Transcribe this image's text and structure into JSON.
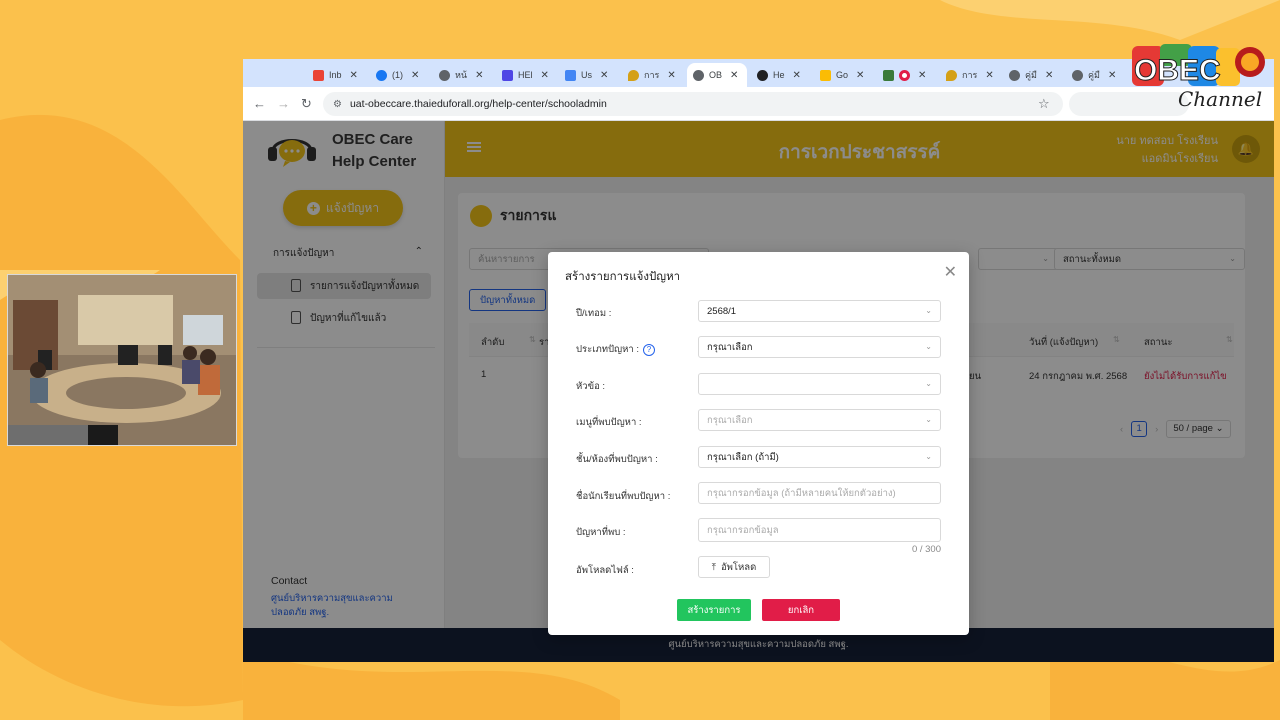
{
  "browser": {
    "tabs": [
      {
        "label": "Inb",
        "icon": "gmail-icon",
        "color": "#ea4335"
      },
      {
        "label": "(1)",
        "icon": "facebook-icon",
        "color": "#1877f2"
      },
      {
        "label": "หน้",
        "icon": "globe-icon",
        "color": "#5f6368"
      },
      {
        "label": "HEl",
        "icon": "chat-icon",
        "color": "#4f46e5"
      },
      {
        "label": "Us",
        "icon": "doc-icon",
        "color": "#4285f4"
      },
      {
        "label": "การ",
        "icon": "drop-icon",
        "color": "#d4a017"
      },
      {
        "label": "OB",
        "icon": "globe-icon",
        "color": "#5f6368"
      },
      {
        "label": "He",
        "icon": "mask-icon",
        "color": "#202124"
      },
      {
        "label": "Go",
        "icon": "keep-icon",
        "color": "#fbbc04"
      },
      {
        "label": "",
        "icon": "record-icon",
        "color": "#e11d48"
      },
      {
        "label": "การ",
        "icon": "drop-icon",
        "color": "#d4a017"
      },
      {
        "label": "คู่มื",
        "icon": "globe-icon",
        "color": "#5f6368"
      },
      {
        "label": "คู่มื",
        "icon": "globe-icon",
        "color": "#5f6368"
      }
    ],
    "url": "uat-obeccare.thaieduforall.org/help-center/schooladmin"
  },
  "sidebar": {
    "brand_line1": "OBEC Care",
    "brand_line2": "Help Center",
    "report_button": "แจ้งปัญหา",
    "menu_heading": "การแจ้งปัญหา",
    "items": [
      {
        "label": "รายการแจ้งปัญหาทั้งหมด"
      },
      {
        "label": "ปัญหาที่แก้ไขแล้ว"
      }
    ],
    "contact_title": "Contact",
    "contact_sub": "ศูนย์บริหารความสุขและความปลอดภัย สพฐ."
  },
  "header": {
    "title": "การเวกประชาสรรค์",
    "user_name": "นาย ทดสอบ โรงเรียน",
    "user_role": "แอดมินโรงเรียน"
  },
  "list": {
    "title": "รายการแ",
    "search_placeholder": "ค้นหารายการ",
    "status_filter": "สถานะทั้งหมด",
    "tab_all": "ปัญหาทั้งหมด",
    "columns": {
      "no": "ลำดับ",
      "col2": "รา",
      "date": "วันที่ (แจ้งปัญหา)",
      "status": "สถานะ"
    },
    "row": {
      "no": "1",
      "partial": "ยน",
      "date": "24 กรกฎาคม พ.ศ. 2568",
      "status": "ยังไม่ได้รับการแก้ไข"
    },
    "page": "1",
    "page_size": "50 / page"
  },
  "footer": "ศูนย์บริหารความสุขและความปลอดภัย สพฐ.",
  "modal": {
    "title": "สร้างรายการแจ้งปัญหา",
    "fields": {
      "year_label": "ปี/เทอม :",
      "year_value": "2568/1",
      "type_label": "ประเภทปัญหา :",
      "type_value": "กรุณาเลือก",
      "topic_label": "หัวข้อ :",
      "topic_value": "",
      "menu_label": "เมนูที่พบปัญหา :",
      "menu_placeholder": "กรุณาเลือก",
      "class_label": "ชั้น/ห้องที่พบปัญหา :",
      "class_value": "กรุณาเลือก (ถ้ามี)",
      "student_label": "ชื่อนักเรียนที่พบปัญหา :",
      "student_placeholder": "กรุณากรอกข้อมูล (ถ้ามีหลายคนให้ยกตัวอย่าง)",
      "problem_label": "ปัญหาที่พบ :",
      "problem_placeholder": "กรุณากรอกข้อมูล",
      "counter": "0 / 300",
      "upload_label": "อัพโหลดไฟล์ :",
      "upload_button": "อัพโหลด"
    },
    "create_button": "สร้างรายการ",
    "cancel_button": "ยกเลิก"
  },
  "channel_logo": {
    "text": "OBEC",
    "script": "Channel"
  }
}
